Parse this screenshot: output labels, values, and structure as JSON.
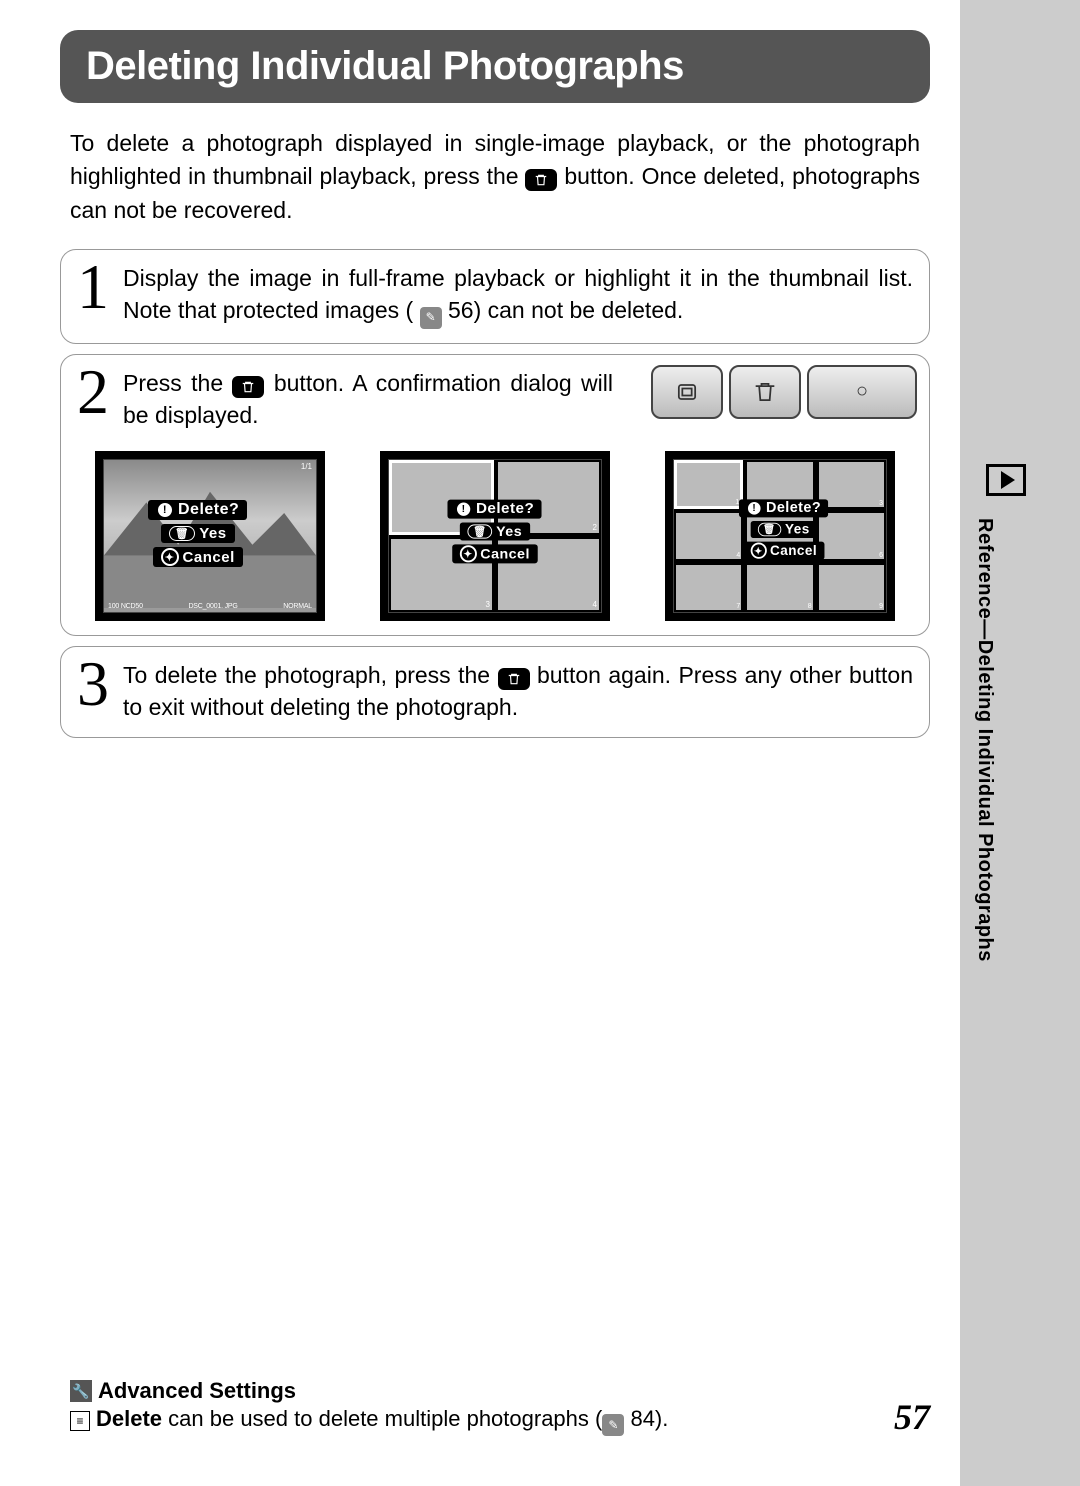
{
  "banner": {
    "title": "Deleting Individual Photographs"
  },
  "intro": {
    "text_a": "To delete a photograph displayed in single-image playback, or the photograph highlighted in thumbnail playback, press the ",
    "text_b": " button.  Once deleted, photographs can not be recovered."
  },
  "steps": {
    "s1": {
      "num": "1",
      "text_a": "Display the image in full-frame playback or highlight it in the thumbnail list.  Note that protected images (",
      "text_b": " 56) can not be deleted."
    },
    "s2": {
      "num": "2",
      "text_a": "Press the ",
      "text_b": " button.  A confirmation dialog will be displayed."
    },
    "s3": {
      "num": "3",
      "text_a": "To delete the photograph, press the ",
      "text_b": " button again.  Press any other button to exit without deleting the photograph."
    }
  },
  "dialog": {
    "delete": "Delete?",
    "yes": "Yes",
    "cancel": "Cancel"
  },
  "screen1": {
    "top": "1/1",
    "footer_a": "100 NCD50",
    "footer_b": "DSC_0001. JPG",
    "footer_c": "NORMAL"
  },
  "side": {
    "label": "Reference—Deleting Individual Photographs"
  },
  "footer": {
    "title": "Advanced Settings",
    "text_a": "Delete",
    "text_b": " can be used to delete multiple photographs (",
    "text_c": " 84)."
  },
  "page_number": "57",
  "icons": {
    "trash": "trash-icon",
    "page_ref": "page-ref-icon",
    "play": "play-icon",
    "menu": "menu-icon",
    "wrench": "wrench-icon"
  }
}
